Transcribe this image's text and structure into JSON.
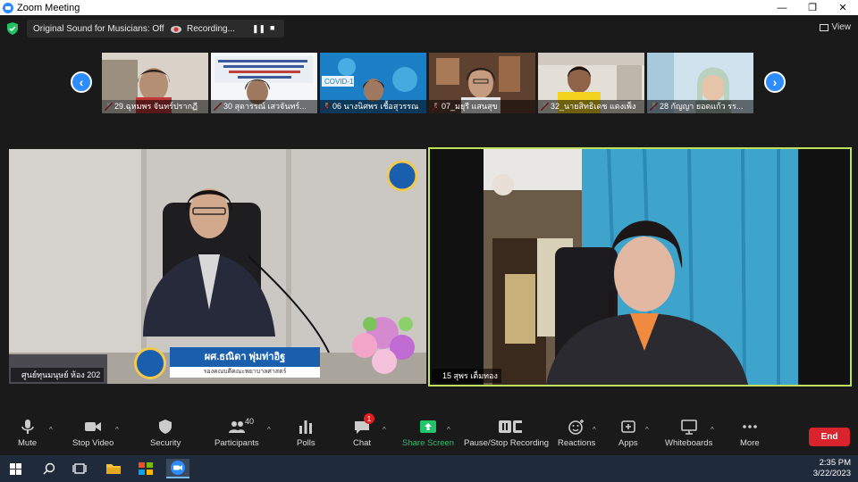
{
  "window": {
    "title": "Zoom Meeting",
    "controls": [
      "—",
      "❐",
      "✕"
    ]
  },
  "topbar": {
    "sound_label": "Original Sound for Musicians: Off",
    "recording_label": "Recording...",
    "view_label": "View"
  },
  "thumbnails": [
    {
      "name": "29.ฉุหมพร จันทร์ปรากฏี"
    },
    {
      "name": "30 สุดารรณ์ เสวจันทร์..."
    },
    {
      "name": "06 นางนิศพร เชื้อสุวรรณ"
    },
    {
      "name": "07_มยุรี แสนสุข"
    },
    {
      "name": "32_นายสิทธิเดช แดงเพ็ง"
    },
    {
      "name": "28 กัญญา ยอดแก้ว รร..."
    }
  ],
  "main_left": {
    "label": "ศูนย์ทุนมนุษย์ ห้อง 202",
    "plate_name": "ผศ.ธณิดา พุ่มท่าอิฐ",
    "plate_role": "รองคณบดีคณะพยาบาลศาสตร์"
  },
  "main_right": {
    "label": "15 สุพร เต็มทอง"
  },
  "toolbar": {
    "mute": "Mute",
    "stop_video": "Stop Video",
    "security": "Security",
    "participants": "Participants",
    "participants_count": "40",
    "polls": "Polls",
    "chat": "Chat",
    "chat_badge": "1",
    "share_screen": "Share Screen",
    "recording": "Pause/Stop Recording",
    "reactions": "Reactions",
    "apps": "Apps",
    "whiteboards": "Whiteboards",
    "more": "More",
    "end": "End"
  },
  "taskbar": {
    "time": "2:35 PM",
    "date": "3/22/2023"
  },
  "colors": {
    "accent": "#2d8cff",
    "active_speaker": "#bfe05a",
    "end": "#d9232d",
    "share": "#21c46b"
  }
}
